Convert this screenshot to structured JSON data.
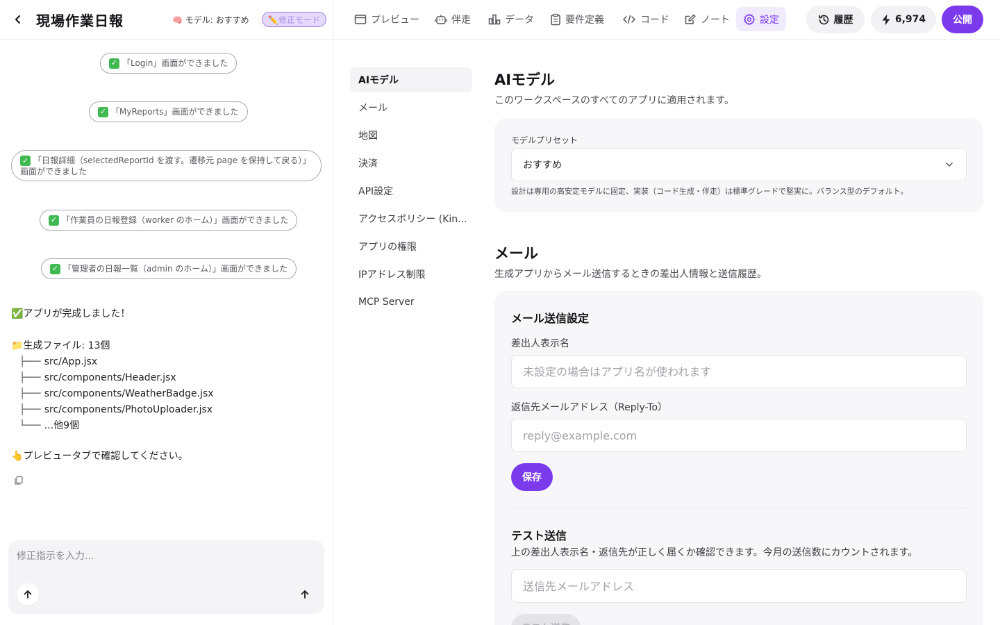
{
  "header": {
    "title": "現場作業日報",
    "model_label": "🧠 モデル: おすすめ",
    "edit_mode": "✏️修正モード"
  },
  "chat": {
    "pills": [
      "「Login」画面ができました",
      "「MyReports」画面ができました",
      "「日報詳細（selectedReportId を渡す。遷移元 page を保持して戻る）」画面ができました",
      "「作業員の日報登録（worker のホーム）」画面ができました",
      "「管理者の日報一覧（admin のホーム）」画面ができました"
    ],
    "complete_msg": "✅アプリが完成しました！",
    "files_heading": "📁生成ファイル: 13個",
    "files": [
      "src/App.jsx",
      "src/components/Header.jsx",
      "src/components/WeatherBadge.jsx",
      "src/components/PhotoUploader.jsx",
      "...他9個"
    ],
    "preview_msg": "👆プレビュータブで確認してください。",
    "input_placeholder": "修正指示を入力..."
  },
  "nav": {
    "tabs": [
      {
        "label": "プレビュー",
        "icon": "window-icon"
      },
      {
        "label": "伴走",
        "icon": "robot-icon"
      },
      {
        "label": "データ",
        "icon": "chart-icon"
      },
      {
        "label": "要件定義",
        "icon": "clipboard-icon"
      },
      {
        "label": "コード",
        "icon": "code-icon"
      },
      {
        "label": "ノート",
        "icon": "note-icon"
      },
      {
        "label": "設定",
        "icon": "gear-icon"
      }
    ],
    "active_tab": "設定",
    "history_label": "履歴",
    "credits": "6,974",
    "publish_label": "公開",
    "accent_color": "#7c3aed"
  },
  "settings_nav": {
    "items": [
      "AIモデル",
      "メール",
      "地図",
      "決済",
      "API設定",
      "アクセスポリシー (Kin...",
      "アプリの権限",
      "IPアドレス制限",
      "MCP Server"
    ],
    "active": "AIモデル"
  },
  "ai_model": {
    "title": "AIモデル",
    "description": "このワークスペースのすべてのアプリに適用されます。",
    "preset_label": "モデルプリセット",
    "preset_value": "おすすめ",
    "preset_hint": "設計は専用の高安定モデルに固定、実装（コード生成・伴走）は標準グレードで堅実に。バランス型のデフォルト。"
  },
  "mail": {
    "title": "メール",
    "description": "生成アプリからメール送信するときの差出人情報と送信履歴。",
    "settings_title": "メール送信設定",
    "sender_label": "差出人表示名",
    "sender_placeholder": "未設定の場合はアプリ名が使われます",
    "reply_label": "返信先メールアドレス（Reply-To）",
    "reply_placeholder": "reply@example.com",
    "save_label": "保存",
    "test_title": "テスト送信",
    "test_description": "上の差出人表示名・返信先が正しく届くか確認できます。今月の送信数にカウントされます。",
    "test_placeholder": "送信先メールアドレス",
    "test_button": "テスト送信"
  }
}
